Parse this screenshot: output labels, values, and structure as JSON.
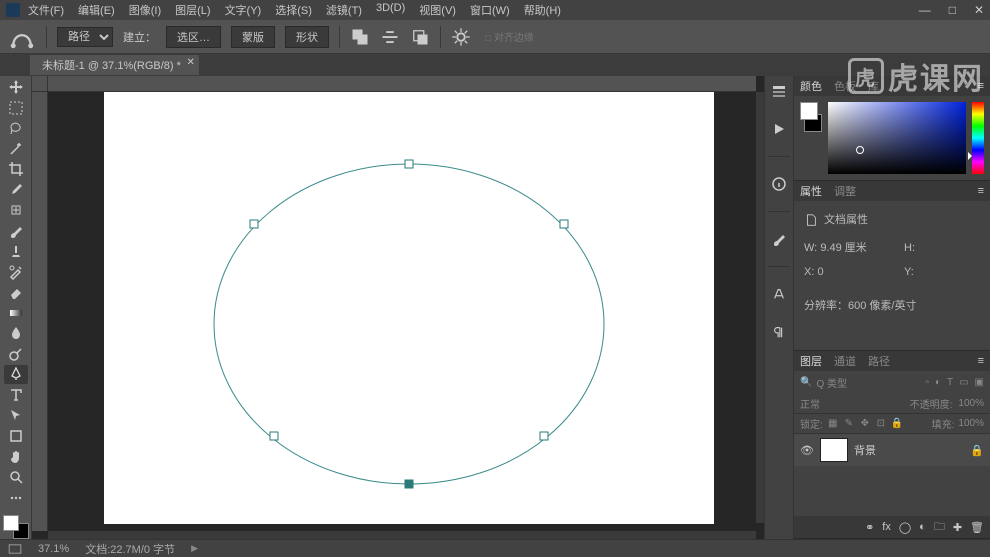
{
  "menubar": {
    "items": [
      "文件(F)",
      "编辑(E)",
      "图像(I)",
      "图层(L)",
      "文字(Y)",
      "选择(S)",
      "滤镜(T)",
      "3D(D)",
      "视图(V)",
      "窗口(W)",
      "帮助(H)"
    ]
  },
  "window_controls": {
    "min": "—",
    "max": "□",
    "close": "✕"
  },
  "optionsbar": {
    "mode_label": "路径",
    "build_label": "建立：",
    "b1": "选区…",
    "b2": "蒙版",
    "b3": "形状",
    "chain_hint": "□ 对齐边缘"
  },
  "doctab": {
    "label": "未标题-1 @ 37.1%(RGB/8) *"
  },
  "tools": [
    "move",
    "rect-marquee",
    "lasso",
    "magic-wand",
    "crop",
    "eyedropper",
    "spot-heal",
    "brush",
    "clone-stamp",
    "history-brush",
    "eraser",
    "gradient",
    "blur",
    "dodge",
    "pen",
    "type",
    "path-select",
    "rectangle",
    "hand",
    "zoom",
    "edit-toolbar"
  ],
  "active_tool_index": 14,
  "collapsed_dock": [
    "history",
    "play",
    "info",
    "brush-settings",
    "character",
    "paragraph"
  ],
  "panels": {
    "color": {
      "tabs": [
        "颜色",
        "色板",
        "库"
      ],
      "active": 0
    },
    "properties": {
      "tabs": [
        "属性",
        "调整"
      ],
      "active": 0,
      "title": "文档属性",
      "w_label": "W:",
      "w_value": "9.49 厘米",
      "h_label": "H:",
      "h_value": "",
      "x_label": "X:",
      "x_value": "0",
      "y_label": "Y:",
      "y_value": "",
      "res_label": "分辨率：600 像素/英寸"
    },
    "layers": {
      "tabs": [
        "图层",
        "通道",
        "路径"
      ],
      "active": 0,
      "kind_label": "Q 类型",
      "blend_label": "正常",
      "opacity_label": "不透明度:",
      "opacity_value": "100%",
      "lock_label": "锁定:",
      "fill_label": "填充:",
      "fill_value": "100%",
      "layer0": {
        "name": "背景"
      }
    }
  },
  "statusbar": {
    "zoom": "37.1%",
    "docinfo": "文档:22.7M/0 字节"
  },
  "watermark": "虎课网"
}
